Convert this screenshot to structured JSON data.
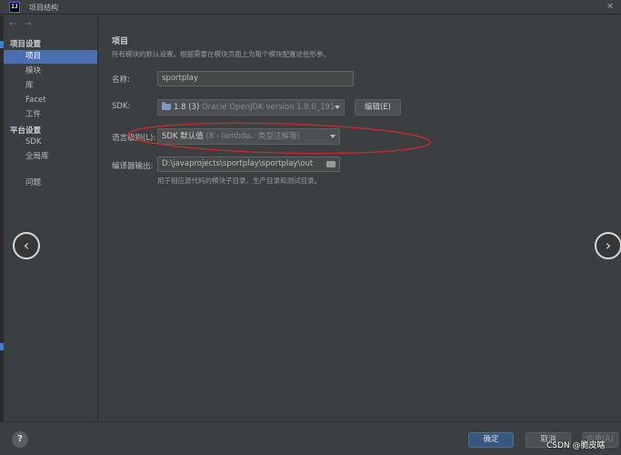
{
  "window": {
    "title": "项目结构",
    "app_icon_text": "IJ",
    "close_glyph": "✕"
  },
  "sidebar": {
    "back_glyph": "←",
    "forward_glyph": "→",
    "group_project": "项目设置",
    "items_project": [
      {
        "label": "项目",
        "selected": true
      },
      {
        "label": "模块"
      },
      {
        "label": "库"
      },
      {
        "label": "Facet"
      },
      {
        "label": "工件"
      }
    ],
    "group_platform": "平台设置",
    "items_platform": [
      {
        "label": "SDK"
      },
      {
        "label": "全局库"
      }
    ],
    "problems": "问题"
  },
  "main": {
    "section_title": "项目",
    "section_desc": "所有模块的默认设置。根据需要在模块页面上为每个模块配置这些形参。",
    "name_label": "名称:",
    "name_value": "sportplay",
    "sdk_label": "SDK:",
    "sdk_value": "1.8 (3)",
    "sdk_detail": "Oracle OpenJDK version 1.8.0_191",
    "edit_button": "编辑(E)",
    "language_level_label": "语言级别(L):",
    "language_level_value": "SDK 默认值",
    "language_level_detail": "(8 - lambda、类型注解等)",
    "compiler_output_label": "编译器输出:",
    "compiler_output_value": "D:\\javaprojects\\sportplay\\sportplay\\out",
    "compiler_output_hint": "用于相应源代码的模块子目录、生产目录和测试目录。"
  },
  "overlay": {
    "prev_glyph": "‹",
    "next_glyph": "›",
    "annotation_color": "#cc2a2a"
  },
  "footer": {
    "help_glyph": "?",
    "ok_button": "确定",
    "cancel_button": "取消",
    "apply_button": "应用(A)"
  },
  "watermark": "CSDN @脆皮瞎"
}
